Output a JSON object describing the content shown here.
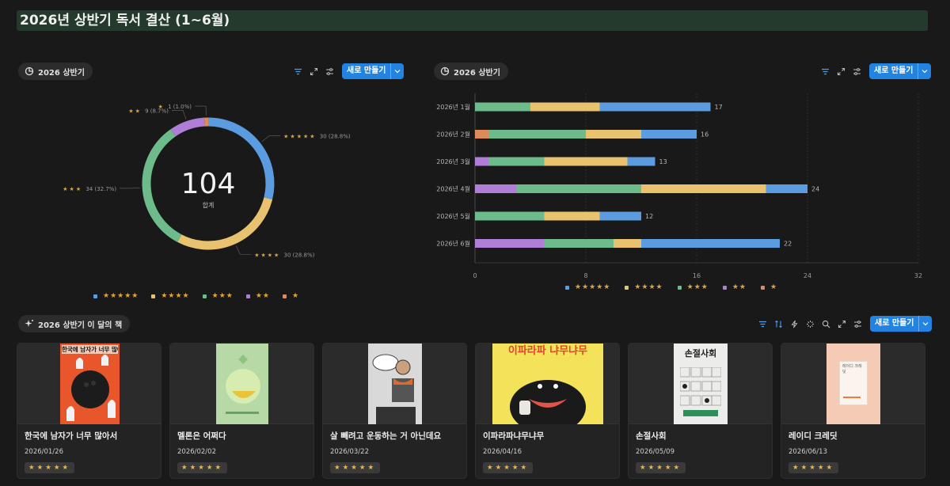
{
  "page": {
    "title": "2026년 상반기 독서 결산 (1~6월)"
  },
  "views": {
    "donut_view": "2026 상반기",
    "bar_view": "2026 상반기",
    "gallery_view": "2026 상반기 이 달의 책",
    "new_button": "새로 만들기"
  },
  "colors": {
    "blue": "#5b9be0",
    "yellow": "#e9c26f",
    "green": "#6dbb8a",
    "purple": "#b07ed6",
    "orange": "#de8a5a",
    "accent": "#2383e2"
  },
  "chart_data": [
    {
      "type": "pie",
      "subtype": "donut",
      "center_value": "104",
      "center_label": "합계",
      "slices": [
        {
          "label": "★★★★★",
          "value": 30,
          "percent": "28.8%",
          "color": "#5b9be0"
        },
        {
          "label": "★★★★",
          "value": 30,
          "percent": "28.8%",
          "color": "#e9c26f"
        },
        {
          "label": "★★★",
          "value": 34,
          "percent": "32.7%",
          "color": "#6dbb8a"
        },
        {
          "label": "★★",
          "value": 9,
          "percent": "8.7%",
          "color": "#b07ed6"
        },
        {
          "label": "★",
          "value": 1,
          "percent": "1.0%",
          "color": "#de8a5a"
        }
      ],
      "legend": [
        "★★★★★",
        "★★★★",
        "★★★",
        "★★",
        "★"
      ],
      "legend_placement": "bottom"
    },
    {
      "type": "bar",
      "orientation": "horizontal",
      "stacked": true,
      "categories": [
        "2026년 1월",
        "2026년 2월",
        "2026년 3월",
        "2026년 4월",
        "2026년 5월",
        "2026년 6월"
      ],
      "series": [
        {
          "name": "★",
          "color": "#de8a5a",
          "values": [
            0,
            1,
            0,
            0,
            0,
            0
          ]
        },
        {
          "name": "★★",
          "color": "#b07ed6",
          "values": [
            0,
            0,
            1,
            3,
            0,
            5
          ]
        },
        {
          "name": "★★★",
          "color": "#6dbb8a",
          "values": [
            4,
            7,
            4,
            9,
            5,
            5
          ]
        },
        {
          "name": "★★★★",
          "color": "#e9c26f",
          "values": [
            5,
            4,
            6,
            9,
            4,
            2
          ]
        },
        {
          "name": "★★★★★",
          "color": "#5b9be0",
          "values": [
            8,
            4,
            2,
            3,
            3,
            10
          ]
        }
      ],
      "totals": [
        17,
        16,
        13,
        24,
        12,
        22
      ],
      "xlim": [
        0,
        32
      ],
      "xticks": [
        "0",
        "8",
        "16",
        "24",
        "32"
      ],
      "legend": [
        "★★★★★",
        "★★★★",
        "★★★",
        "★★",
        "★"
      ],
      "legend_placement": "bottom"
    }
  ],
  "gallery": {
    "cards": [
      {
        "title": "한국에 남자가 너무 많아서",
        "date": "2026/01/26",
        "rating": "★★★★★",
        "cover_text": "한국에 남자가 너무 많아서"
      },
      {
        "title": "멜론은 어쩌다",
        "date": "2026/02/02",
        "rating": "★★★★★",
        "cover_text": ""
      },
      {
        "title": "살 빼려고 운동하는 거 아닌데요",
        "date": "2026/03/22",
        "rating": "★★★★★",
        "cover_text": ""
      },
      {
        "title": "이파라파냐무냐무",
        "date": "2026/04/16",
        "rating": "★★★★★",
        "cover_text": "이파라파 냐무냐무"
      },
      {
        "title": "손절사회",
        "date": "2026/05/09",
        "rating": "★★★★★",
        "cover_text": "손절사회"
      },
      {
        "title": "레이디 크레딧",
        "date": "2026/06/13",
        "rating": "★★★★★",
        "cover_text": "레이디 크레딧"
      }
    ]
  }
}
